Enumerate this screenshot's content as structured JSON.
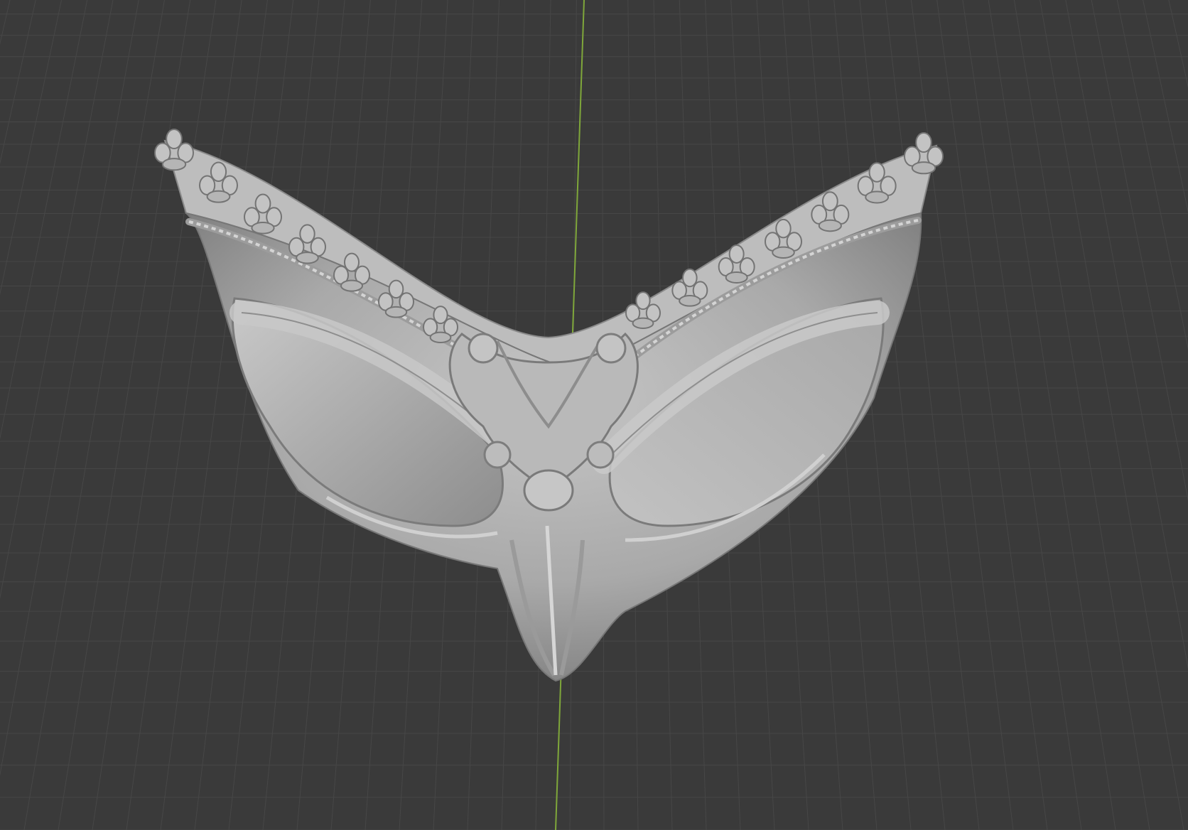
{
  "viewport": {
    "background_color": "#3a3a3a",
    "grid_color": "#474747",
    "y_axis_color": "#7fa73a",
    "object_color": "#b4b4b4"
  },
  "scene": {
    "object_icon": "sculpted-bustier-mesh",
    "grid_visible": true,
    "axis_visible": "y"
  }
}
